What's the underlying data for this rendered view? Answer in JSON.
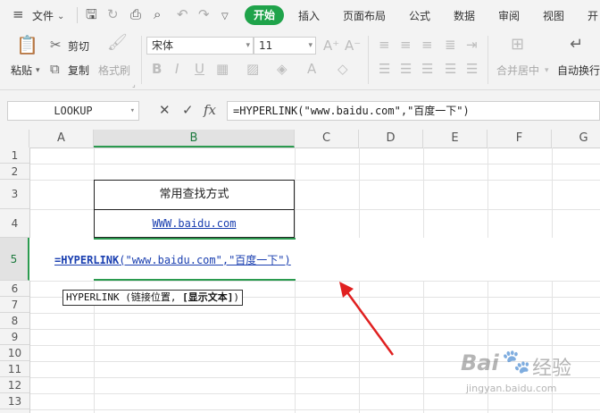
{
  "menu": {
    "file_label": "文件",
    "tabs": [
      "开始",
      "插入",
      "页面布局",
      "公式",
      "数据",
      "审阅",
      "视图",
      "开"
    ],
    "active_tab": "开始"
  },
  "ribbon": {
    "paste_label": "粘贴",
    "cut_label": "剪切",
    "copy_label": "复制",
    "format_painter_label": "格式刷",
    "font_name": "宋体",
    "font_size": "11",
    "merge_label": "合并居中",
    "wrap_label": "自动换行"
  },
  "formula_bar": {
    "name_box": "LOOKUP",
    "cancel_symbol": "✕",
    "confirm_symbol": "✓",
    "fx_symbol": "fx",
    "formula": "=HYPERLINK(\"www.baidu.com\",\"百度一下\")"
  },
  "columns": [
    "A",
    "B",
    "C",
    "D",
    "E",
    "F",
    "G"
  ],
  "rows": [
    "1",
    "2",
    "3",
    "4",
    "5",
    "6",
    "7",
    "8",
    "9",
    "10",
    "11",
    "12",
    "13"
  ],
  "cells": {
    "b3": "常用查找方式",
    "b4": "WWW.baidu.com"
  },
  "editing": {
    "func": "=HYPERLINK",
    "args": "(\"www.baidu.com\",\"百度一下\")"
  },
  "tooltip": {
    "func": "HYPERLINK",
    "params": "(链接位置, ",
    "optional": "[显示文本]",
    "close": ")"
  },
  "watermark": {
    "brand": "Bai",
    "brand2": "经验",
    "url": "jingyan.baidu.com"
  },
  "colors": {
    "accent_green": "#1fa34a",
    "link_blue": "#1a3fb0",
    "arrow_red": "#e02020"
  }
}
